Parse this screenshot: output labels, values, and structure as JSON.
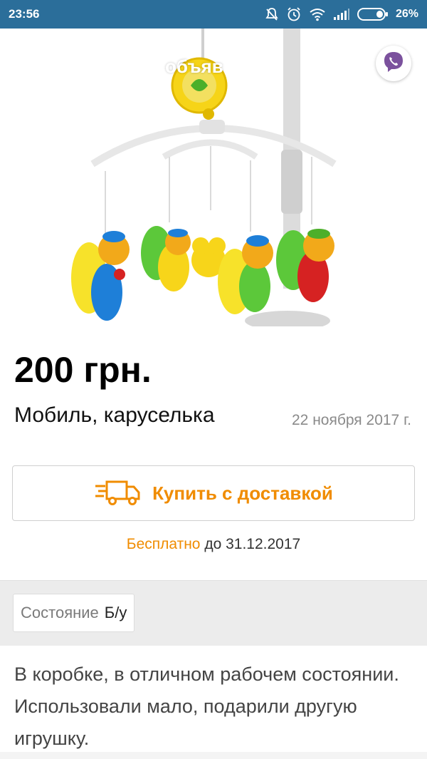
{
  "status_bar": {
    "time": "23:56",
    "battery": "26%",
    "icons": [
      "mute-icon",
      "alarm-icon",
      "wifi-icon",
      "signal-icon",
      "battery-icon"
    ]
  },
  "hero": {
    "overlay_title": "объяв",
    "share_icon": "viber-icon"
  },
  "ad": {
    "price": "200 грн.",
    "title": "Мобиль, каруселька",
    "date": "22 ноября 2017 г."
  },
  "buy": {
    "label": "Купить с доставкой",
    "icon": "delivery-truck-icon",
    "accent": "#f08c00"
  },
  "delivery": {
    "free": "Бесплатно",
    "until": "до 31.12.2017"
  },
  "params": {
    "condition_name": "Состояние",
    "condition_value": "Б/у"
  },
  "description": "В коробке, в отличном рабочем состоянии. Использовали мало, подарили другую игрушку."
}
